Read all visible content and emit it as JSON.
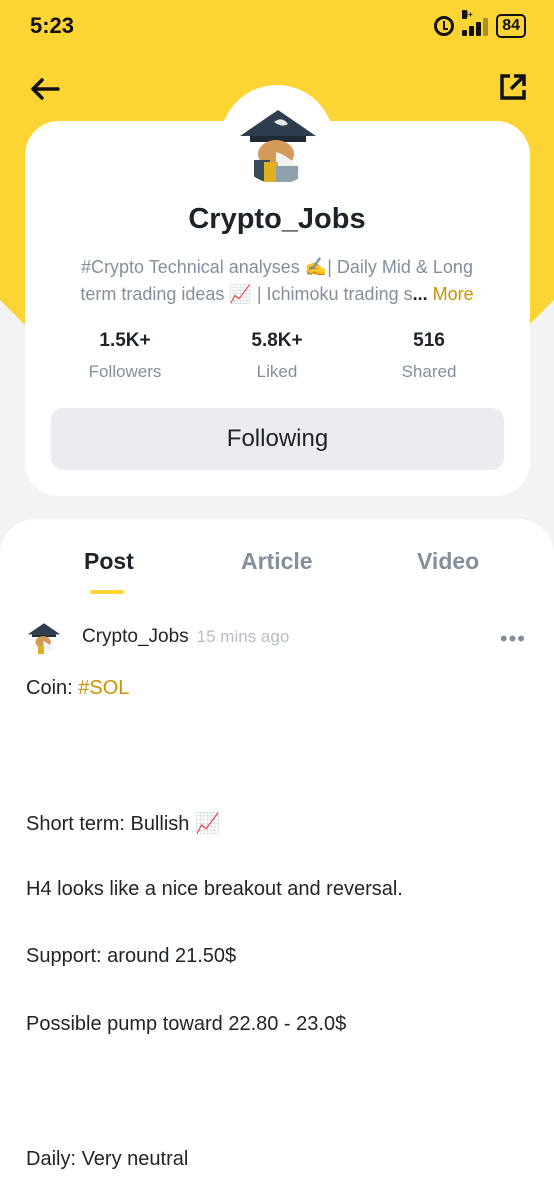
{
  "status_bar": {
    "time": "5:23",
    "network": "H+",
    "battery": "84"
  },
  "profile": {
    "username": "Crypto_Jobs",
    "bio_line1": "#Crypto Technical analyses ✍️| Daily Mid & Long",
    "bio_line2": "term trading ideas 📈 | Ichimoku trading s",
    "bio_ellipsis": "...",
    "bio_more": "More",
    "stats": [
      {
        "value": "1.5K+",
        "label": "Followers"
      },
      {
        "value": "5.8K+",
        "label": "Liked"
      },
      {
        "value": "516",
        "label": "Shared"
      }
    ],
    "follow_label": "Following"
  },
  "tabs": [
    "Post",
    "Article",
    "Video"
  ],
  "post": {
    "author": "Crypto_Jobs",
    "time": "15 mins ago",
    "coin_prefix": "Coin: ",
    "coin_tag": "#SOL",
    "lines": [
      "Short term: Bullish 📈",
      "H4 looks like a nice breakout and reversal.",
      "Support: around 21.50$",
      "Possible pump toward 22.80 - 23.0$",
      "Daily: Very neutral"
    ]
  },
  "colors": {
    "brand_yellow": "#fcd535",
    "accent_gold": "#c99400",
    "text_primary": "#1e2329",
    "text_secondary": "#848e9c"
  }
}
